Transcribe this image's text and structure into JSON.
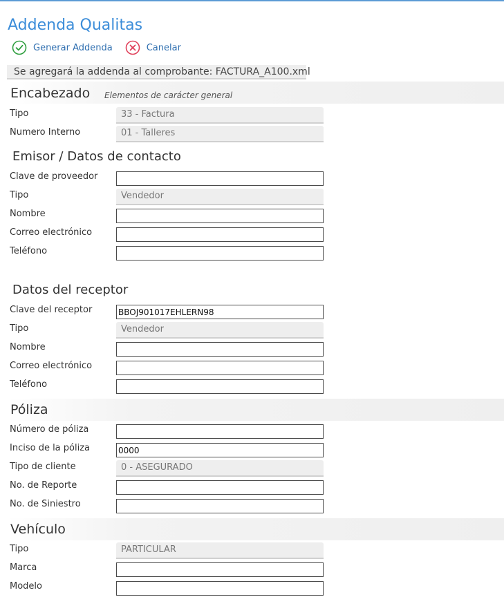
{
  "app": {
    "title": "Addenda Qualitas"
  },
  "toolbar": {
    "generate_label": "Generar Addenda",
    "cancel_label": "Canelar"
  },
  "banner": {
    "text": "Se agregará la addenda al comprobante: FACTURA_A100.xml"
  },
  "encabezado": {
    "title": "Encabezado",
    "subtitle": "Elementos de carácter general",
    "tipo_label": "Tipo",
    "tipo_value": "33 - Factura",
    "numero_label": "Numero Interno",
    "numero_value": "01 - Talleres"
  },
  "emisor": {
    "title": "Emisor / Datos de contacto",
    "clave_label": "Clave de proveedor",
    "clave_value": "",
    "tipo_label": "Tipo",
    "tipo_value": "Vendedor",
    "nombre_label": "Nombre",
    "nombre_value": "",
    "correo_label": "Correo electrónico",
    "correo_value": "",
    "telefono_label": "Teléfono",
    "telefono_value": ""
  },
  "receptor": {
    "title": "Datos del receptor",
    "clave_label": "Clave del receptor",
    "clave_value": "BBOJ901017EHLERN98",
    "tipo_label": "Tipo",
    "tipo_value": "Vendedor",
    "nombre_label": "Nombre",
    "nombre_value": "",
    "correo_label": "Correo electrónico",
    "correo_value": "",
    "telefono_label": "Teléfono",
    "telefono_value": ""
  },
  "poliza": {
    "title": "Póliza",
    "numero_label": "Número de póliza",
    "numero_value": "",
    "inciso_label": "Inciso de la póliza",
    "inciso_value": "0000",
    "tipo_cliente_label": "Tipo de cliente",
    "tipo_cliente_value": "0 - ASEGURADO",
    "reporte_label": "No. de Reporte",
    "reporte_value": "",
    "siniestro_label": "No. de Siniestro",
    "siniestro_value": ""
  },
  "vehiculo": {
    "title": "Vehículo",
    "tipo_label": "Tipo",
    "tipo_value": "PARTICULAR",
    "marca_label": "Marca",
    "marca_value": "",
    "modelo_label": "Modelo",
    "modelo_value": ""
  },
  "colors": {
    "accent": "#3c8dd9",
    "link": "#2f6fb0",
    "ok_icon": "#2e9e3e",
    "cancel_icon": "#e0405a"
  },
  "icons": {
    "generate": "check-circle-icon",
    "cancel": "x-circle-icon"
  }
}
